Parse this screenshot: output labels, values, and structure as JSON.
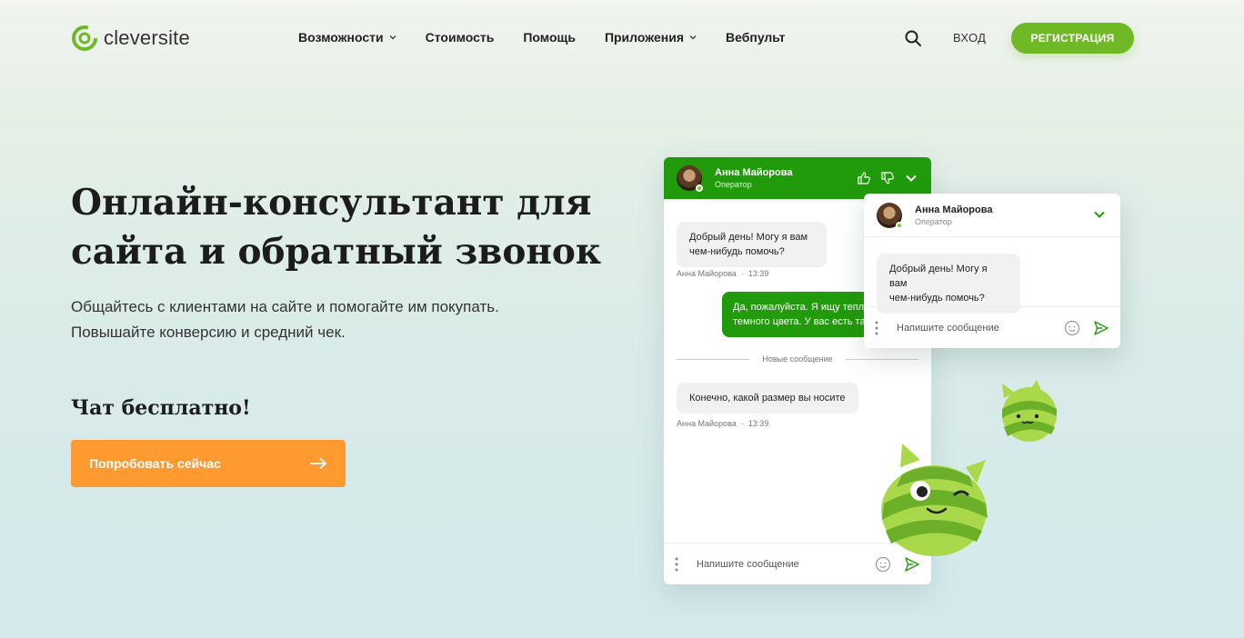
{
  "header": {
    "logo_text": "cleversite",
    "nav": [
      {
        "label": "Возможности",
        "has_dropdown": true
      },
      {
        "label": "Стоимость",
        "has_dropdown": false
      },
      {
        "label": "Помощь",
        "has_dropdown": false
      },
      {
        "label": "Приложения",
        "has_dropdown": true
      },
      {
        "label": "Вебпульт",
        "has_dropdown": false
      }
    ],
    "login_label": "ВХОД",
    "register_label": "РЕГИСТРАЦИЯ"
  },
  "hero": {
    "title_line1": "Онлайн-консультант для",
    "title_line2": "сайта и обратный звонок",
    "subtitle_line1": "Общайтесь с клиентами на сайте и помогайте им покупать.",
    "subtitle_line2": "Повышайте конверсию и средний чек.",
    "free_label": "Чат бесплатно!",
    "cta_label": "Попробовать сейчас"
  },
  "chat_main": {
    "operator_name": "Анна Майорова",
    "operator_role": "Оператор",
    "message1_line1": "Добрый день! Могу я вам",
    "message1_line2": "чем-нибудь помочь?",
    "message1_author": "Анна Майорова",
    "message1_time": "13:39",
    "reply_line1": "Да, пожалуйста. Я ищу теплую",
    "reply_line2": "темного цвета. У вас есть така",
    "divider_label": "Новые сообщение",
    "message2": "Конечно, какой размер вы носите",
    "message2_author": "Анна Майорова",
    "message2_time": "13:39",
    "input_placeholder": "Напишите сообщение"
  },
  "chat_mini": {
    "operator_name": "Анна Майорова",
    "operator_role": "Оператор",
    "message_line1": "Добрый день! Могу я вам",
    "message_line2": "чем-нибудь помочь?",
    "input_placeholder": "Напишите сообщение"
  },
  "colors": {
    "brand_green": "#6fb927",
    "chat_green": "#219a0b",
    "cta_orange": "#ff9a30"
  }
}
